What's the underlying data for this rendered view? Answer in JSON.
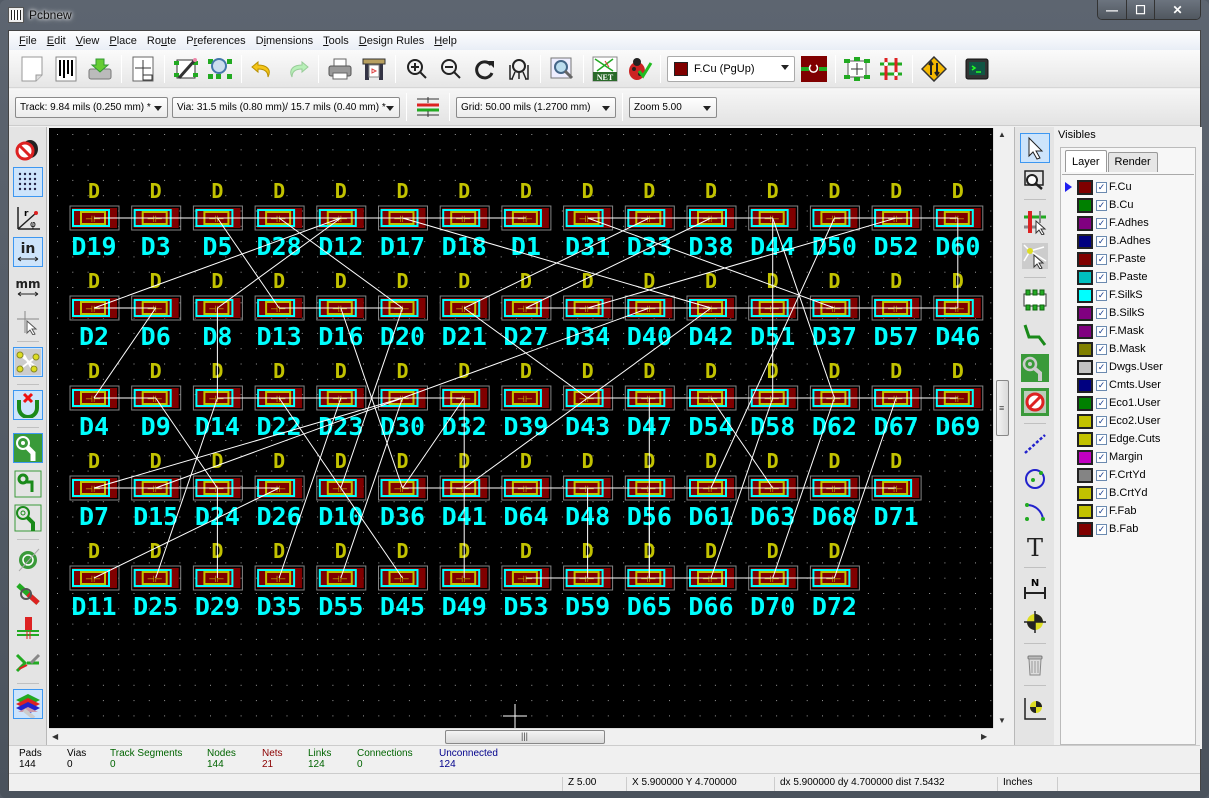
{
  "window": {
    "title": "Pcbnew",
    "controls": {
      "minimize": "—",
      "maximize": "☐",
      "close": "✕"
    }
  },
  "menubar": [
    {
      "label": "File",
      "mnemonic": "F"
    },
    {
      "label": "Edit",
      "mnemonic": "E"
    },
    {
      "label": "View",
      "mnemonic": "V"
    },
    {
      "label": "Place",
      "mnemonic": "P"
    },
    {
      "label": "Route",
      "mnemonic": "u"
    },
    {
      "label": "Preferences",
      "mnemonic": "r"
    },
    {
      "label": "Dimensions",
      "mnemonic": "i"
    },
    {
      "label": "Tools",
      "mnemonic": "T"
    },
    {
      "label": "Design Rules",
      "mnemonic": "D"
    },
    {
      "label": "Help",
      "mnemonic": "H"
    }
  ],
  "main_toolbar": {
    "buttons": [
      "new-board",
      "open-board",
      "save-board",
      "page-settings",
      "module-editor",
      "module-viewer",
      "undo",
      "redo",
      "print",
      "plot",
      "zoom-in",
      "zoom-out",
      "redraw",
      "zoom-fit",
      "find",
      "netlist",
      "drc",
      "layer-pair",
      "ratsnest",
      "autoplace",
      "microwave",
      "scripting-console"
    ],
    "active_layer": {
      "label": "F.Cu (PgUp)",
      "color": "#800000"
    }
  },
  "aux_toolbar": {
    "track": "Track: 9.84 mils (0.250 mm) *",
    "via": "Via: 31.5 mils (0.80 mm)/ 15.7 mils (0.40 mm) *",
    "grid": "Grid: 50.00 mils (1.2700 mm)",
    "zoom": "Zoom 5.00"
  },
  "left_toolbar": [
    "drc-off",
    "grid-toggle",
    "polar-coords",
    "units-inches",
    "units-mm",
    "cursor-shape",
    "ratsnest-toggle",
    "local-ratsnest",
    "pad-fill",
    "track-sketch",
    "via-sketch",
    "zone-fill",
    "high-contrast",
    "show-microwave",
    "layer-manager"
  ],
  "right_toolbar": [
    "select",
    "highlight-net",
    "local-ratsnest",
    "module",
    "track",
    "via",
    "zone",
    "keepout",
    "line",
    "circle",
    "arc",
    "text",
    "dimension",
    "target",
    "delete",
    "grid-origin"
  ],
  "visibles": {
    "title": "Visibles",
    "tabs": [
      "Layer",
      "Render"
    ],
    "active_tab": "Layer",
    "layers": [
      {
        "name": "F.Cu",
        "color": "#800000",
        "checked": true,
        "active": true
      },
      {
        "name": "B.Cu",
        "color": "#008000",
        "checked": true
      },
      {
        "name": "F.Adhes",
        "color": "#800080",
        "checked": true
      },
      {
        "name": "B.Adhes",
        "color": "#000080",
        "checked": true
      },
      {
        "name": "F.Paste",
        "color": "#800000",
        "checked": true
      },
      {
        "name": "B.Paste",
        "color": "#00c0c0",
        "checked": true
      },
      {
        "name": "F.SilkS",
        "color": "#00ffff",
        "checked": true
      },
      {
        "name": "B.SilkS",
        "color": "#800080",
        "checked": true
      },
      {
        "name": "F.Mask",
        "color": "#800080",
        "checked": true
      },
      {
        "name": "B.Mask",
        "color": "#808000",
        "checked": true
      },
      {
        "name": "Dwgs.User",
        "color": "#c2c2c2",
        "checked": true
      },
      {
        "name": "Cmts.User",
        "color": "#000080",
        "checked": true
      },
      {
        "name": "Eco1.User",
        "color": "#008000",
        "checked": true
      },
      {
        "name": "Eco2.User",
        "color": "#c2c200",
        "checked": true
      },
      {
        "name": "Edge.Cuts",
        "color": "#c2c200",
        "checked": true
      },
      {
        "name": "Margin",
        "color": "#c200c2",
        "checked": true
      },
      {
        "name": "F.CrtYd",
        "color": "#848484",
        "checked": true
      },
      {
        "name": "B.CrtYd",
        "color": "#c2c200",
        "checked": true
      },
      {
        "name": "F.Fab",
        "color": "#c2c200",
        "checked": true
      },
      {
        "name": "B.Fab",
        "color": "#800000",
        "checked": true
      }
    ]
  },
  "board": {
    "value_label": "D",
    "rows": [
      [
        "D19",
        "D3",
        "D5",
        "D28",
        "D12",
        "D17",
        "D18",
        "D1",
        "D31",
        "D33",
        "D38",
        "D44",
        "D50",
        "D52",
        "D60"
      ],
      [
        "D2",
        "D6",
        "D8",
        "D13",
        "D16",
        "D20",
        "D21",
        "D27",
        "D34",
        "D40",
        "D42",
        "D51",
        "D37",
        "D57",
        "D46"
      ],
      [
        "D4",
        "D9",
        "D14",
        "D22",
        "D23",
        "D30",
        "D32",
        "D39",
        "D43",
        "D47",
        "D54",
        "D58",
        "D62",
        "D67",
        "D69"
      ],
      [
        "D7",
        "D15",
        "D24",
        "D26",
        "D10",
        "D36",
        "D41",
        "D64",
        "D48",
        "D56",
        "D61",
        "D63",
        "D68",
        "D71"
      ],
      [
        "D11",
        "D25",
        "D29",
        "D35",
        "D55",
        "D45",
        "D49",
        "D53",
        "D59",
        "D65",
        "D66",
        "D70",
        "D72"
      ]
    ],
    "colors": {
      "background": "#000000",
      "silk": "#00ffff",
      "value": "#c2c200",
      "pad": "#800000",
      "ratsnest": "#ffffff",
      "courtyard": "#848484"
    }
  },
  "message_panel": [
    {
      "label": "Pads",
      "value": "144",
      "color": "#000000"
    },
    {
      "label": "Vias",
      "value": "0",
      "color": "#000000"
    },
    {
      "label": "Track Segments",
      "value": "0",
      "color": "#006400"
    },
    {
      "label": "Nodes",
      "value": "144",
      "color": "#006400"
    },
    {
      "label": "Nets",
      "value": "21",
      "color": "#8b0000"
    },
    {
      "label": "Links",
      "value": "124",
      "color": "#006400"
    },
    {
      "label": "Connections",
      "value": "0",
      "color": "#006400"
    },
    {
      "label": "Unconnected",
      "value": "124",
      "color": "#00008b"
    }
  ],
  "statusbar": {
    "zoom": "Z 5.00",
    "coords": "X 5.900000  Y 4.700000",
    "delta": "dx 5.900000  dy 4.700000  dist 7.5432",
    "units": "Inches"
  }
}
